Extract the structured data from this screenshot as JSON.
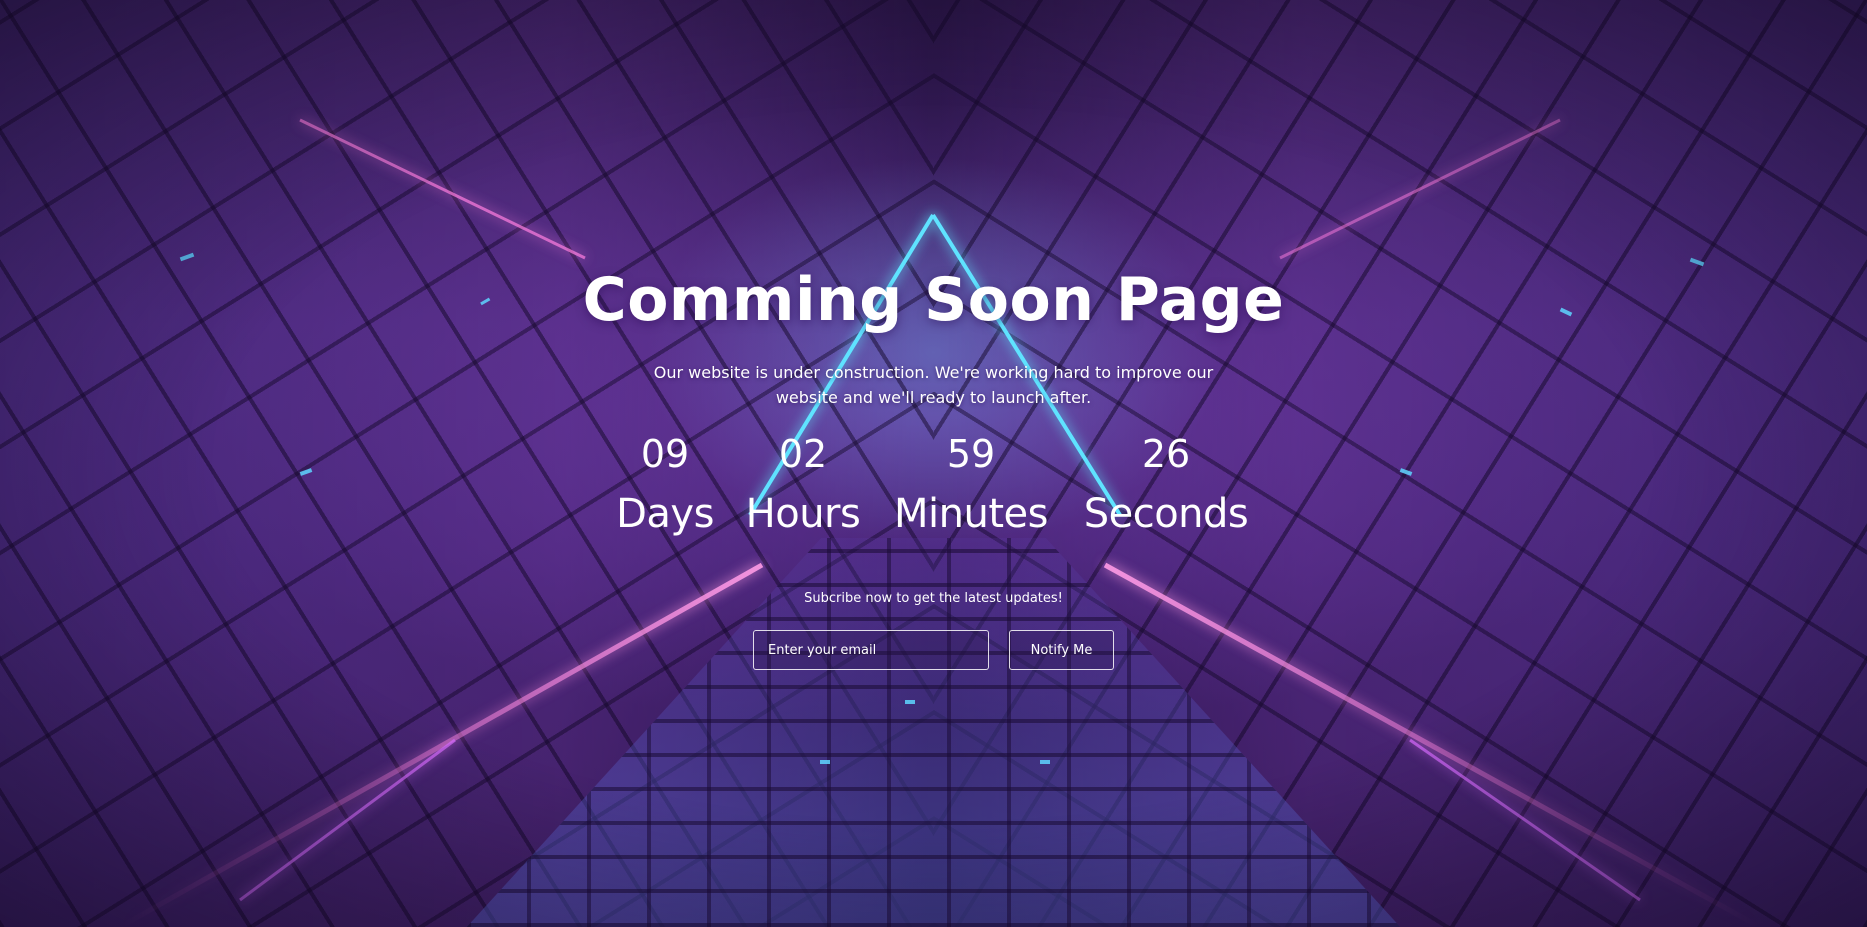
{
  "hero": {
    "title": "Comming Soon Page",
    "subtitle": "Our website is under construction. We're working hard to improve our website and we'll ready to launch after."
  },
  "countdown": {
    "days": {
      "value": "09",
      "label": "Days"
    },
    "hours": {
      "value": "02",
      "label": "Hours"
    },
    "minutes": {
      "value": "59",
      "label": "Minutes"
    },
    "seconds": {
      "value": "26",
      "label": "Seconds"
    }
  },
  "subscribe": {
    "text": "Subcribe now to get the latest updates!",
    "email_placeholder": "Enter your email",
    "email_value": "",
    "button_label": "Notify Me"
  },
  "theme": {
    "background": "#3a1d63",
    "neon_cyan": "#5fe3ff",
    "neon_magenta": "#ff4fd8",
    "text": "#ffffff"
  }
}
